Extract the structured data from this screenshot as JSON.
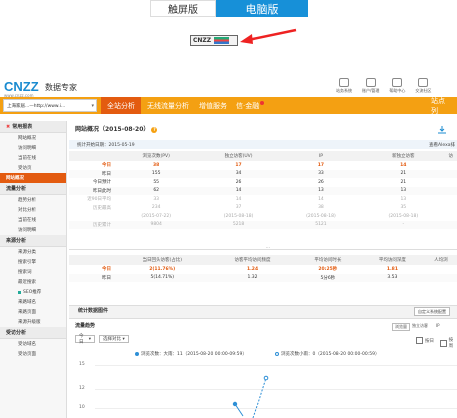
{
  "toggle": {
    "touch": "触屏版",
    "pc": "电脑版"
  },
  "badge": {
    "text": "CNZZ"
  },
  "header": {
    "logo": "CNZZ",
    "logo_sub": "www.cnzz.com",
    "brand": "数据专家",
    "top_links": [
      "站务系统",
      "账户/管理",
      "帮助中心",
      "交流社区"
    ]
  },
  "nav": {
    "site": "上海家居...—http://www.i...",
    "items": [
      "全站分析",
      "无线流量分析",
      "增值服务",
      "信·金融"
    ],
    "right": "站点列"
  },
  "sidebar": {
    "sections": [
      {
        "head": "常用报表",
        "red": true,
        "items": [
          "网站概况",
          "访问明细",
          "当前在线",
          "受访页"
        ]
      },
      {
        "active": "网站概况"
      },
      {
        "head": "流量分析",
        "items": [
          "趋势分析",
          "对比分析",
          "当前在线",
          "访问明细"
        ]
      },
      {
        "head": "来源分析",
        "items": [
          "来源分类",
          "搜索引擎",
          "搜索词",
          "最近搜索",
          "SEO推荐",
          "来路域名",
          "来路页面",
          "来源升级版"
        ]
      },
      {
        "head": "受访分析",
        "items": [
          "受访域名",
          "受访页面"
        ]
      }
    ]
  },
  "main": {
    "title": "网站概况（2015-08-20）",
    "strip_left": "统计开始日期：2015-05-19",
    "strip_right": "查看Alexa排",
    "table1": {
      "headers": [
        "浏览次数(PV)",
        "独立访客(UV)",
        "IP",
        "新独立访客",
        "访"
      ],
      "rows": [
        {
          "label": "今日",
          "cells": [
            "38",
            "17",
            "17",
            "14",
            ""
          ],
          "cls": "today"
        },
        {
          "label": "昨日",
          "cells": [
            "155",
            "34",
            "33",
            "21",
            ""
          ]
        },
        {
          "label": "今日预计",
          "cells": [
            "55",
            "26",
            "26",
            "21",
            ""
          ]
        },
        {
          "label": "昨日此时",
          "cells": [
            "62",
            "14",
            "13",
            "13",
            ""
          ]
        },
        {
          "label": "近90日平均",
          "cells": [
            "33",
            "14",
            "14",
            "13",
            ""
          ],
          "cls": "grey"
        },
        {
          "label": "历史最高",
          "cells": [
            "234",
            "37",
            "38",
            "35",
            ""
          ],
          "cls": "grey"
        },
        {
          "label": "",
          "cells": [
            "(2015-07-22)",
            "(2015-08-18)",
            "(2015-08-18)",
            "(2015-08-18)",
            ""
          ],
          "cls": "grey"
        },
        {
          "label": "历史累计",
          "cells": [
            "9804",
            "5218",
            "5121",
            "-",
            ""
          ],
          "cls": "grey"
        }
      ]
    },
    "table2": {
      "headers": [
        "当日回头访客(占比)",
        "访客平均访问频度",
        "平均访问时长",
        "平均访问深度",
        "人均浏"
      ],
      "rows": [
        {
          "label": "今日",
          "cells": [
            "2(11.76%)",
            "1.24",
            "20:25秒",
            "1.81",
            ""
          ],
          "cls": "today"
        },
        {
          "label": "昨日",
          "cells": [
            "5(14.71%)",
            "1.32",
            "5分6秒",
            "3.53",
            ""
          ]
        }
      ]
    },
    "trend": {
      "section_title": "统计数据图件",
      "section_btn": "自定义系统配置",
      "sub_title": "流量趋势",
      "sub_right": [
        "浏览量",
        "独立访客",
        "IP"
      ],
      "day_sel": "今日",
      "compare_sel": "选择对比",
      "checks": [
        "按日",
        "按周"
      ],
      "legend": [
        {
          "text": "浏览次数：大雨：11（2015-08-20 00:00-09:59）",
          "color": "#2d8fd6"
        },
        {
          "text": "浏览次数小雨：0（2015-08-20 00:00-00:59）",
          "color": "#2d8fd6"
        }
      ],
      "yticks": [
        "15",
        "12",
        "10"
      ]
    }
  }
}
